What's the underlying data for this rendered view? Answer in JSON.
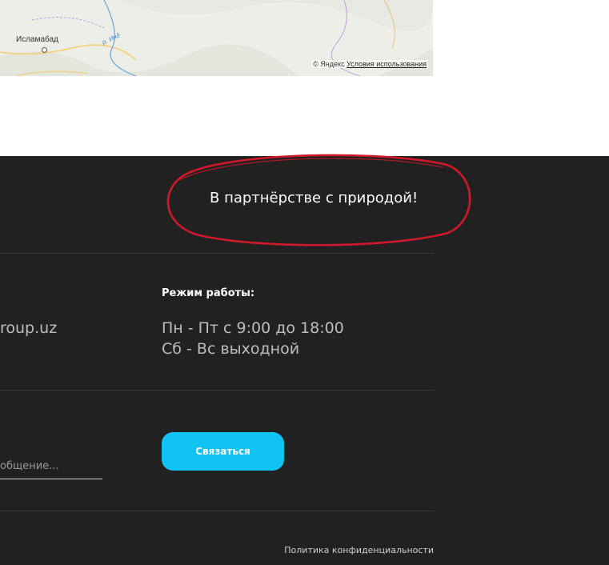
{
  "map": {
    "city_label": "Исламабад",
    "river_label": "р. Инд",
    "copyright": "© Яндекс",
    "terms_link": "Условия использования"
  },
  "footer": {
    "slogan": "В партнёрстве с природой!",
    "email_partial": "roup.uz",
    "hours": {
      "heading": "Режим работы:",
      "line1": "Пн - Пт с 9:00 до 18:00",
      "line2": "Сб - Вс выходной"
    },
    "message_placeholder": "общение...",
    "contact_button": "Связаться",
    "privacy_link": "Политика конфиденциальности"
  },
  "colors": {
    "footer_bg": "#222121",
    "accent_button": "#11c3f2",
    "annotation_ellipse": "#d0182a"
  }
}
